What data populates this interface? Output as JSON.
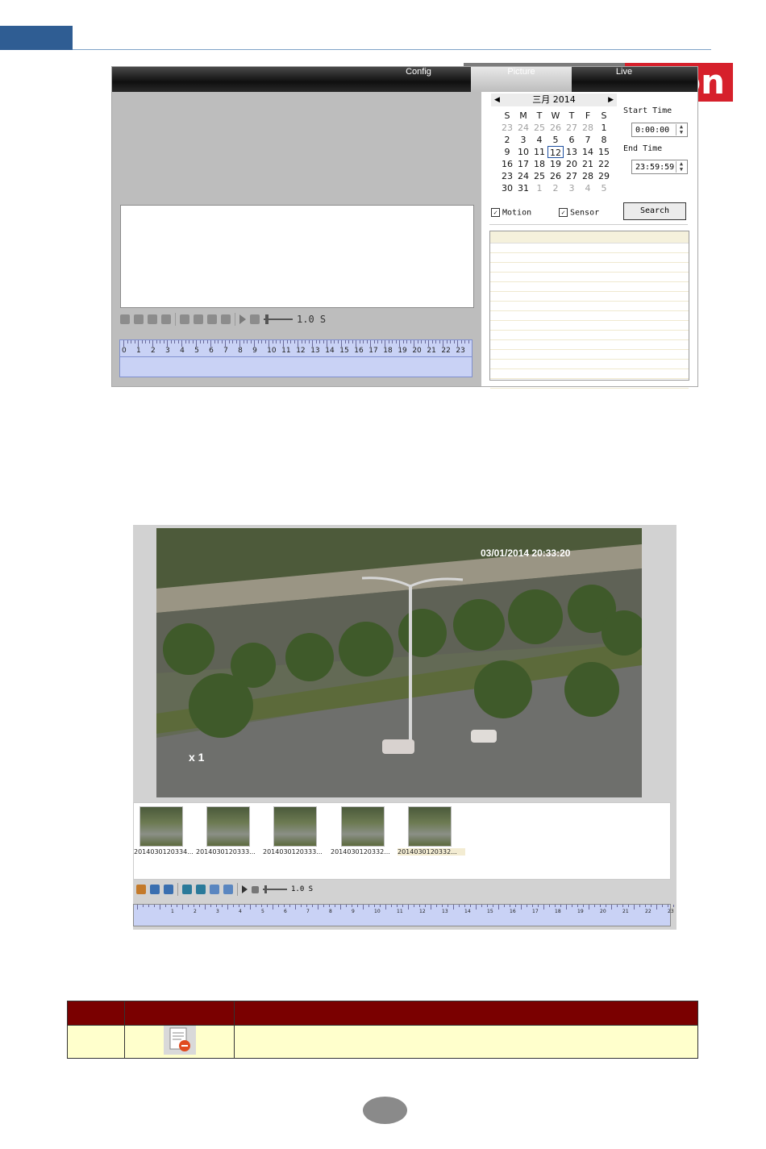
{
  "header_nav": {
    "tabs": [
      "Config",
      "Picture",
      "Live"
    ],
    "active": "Picture"
  },
  "brand_text": "on",
  "calendar": {
    "month_label": "三月 2014",
    "weekdays": [
      "S",
      "M",
      "T",
      "W",
      "T",
      "F",
      "S"
    ],
    "weeks": [
      [
        "23",
        "24",
        "25",
        "26",
        "27",
        "28",
        "1"
      ],
      [
        "2",
        "3",
        "4",
        "5",
        "6",
        "7",
        "8"
      ],
      [
        "9",
        "10",
        "11",
        "12",
        "13",
        "14",
        "15"
      ],
      [
        "16",
        "17",
        "18",
        "19",
        "20",
        "21",
        "22"
      ],
      [
        "23",
        "24",
        "25",
        "26",
        "27",
        "28",
        "29"
      ],
      [
        "30",
        "31",
        "1",
        "2",
        "3",
        "4",
        "5"
      ]
    ],
    "selected_day": "12"
  },
  "search_panel": {
    "start_label": "Start Time",
    "start_value": "0:00:00",
    "end_label": "End Time",
    "end_value": "23:59:59",
    "motion_label": "Motion",
    "sensor_label": "Sensor",
    "search_button": "Search"
  },
  "playback": {
    "speed": "1.0 S",
    "hours": [
      "0",
      "1",
      "2",
      "3",
      "4",
      "5",
      "6",
      "7",
      "8",
      "9",
      "10",
      "11",
      "12",
      "13",
      "14",
      "15",
      "16",
      "17",
      "18",
      "19",
      "20",
      "21",
      "22",
      "23"
    ]
  },
  "video": {
    "timestamp": "03/01/2014 20:33:20",
    "zoom_label": "x 1"
  },
  "thumbnails": [
    "2014030120334...",
    "2014030120333...",
    "2014030120333...",
    "2014030120332...",
    "2014030120332..."
  ],
  "playback2": {
    "speed": "1.0 S",
    "hours": [
      "1",
      "2",
      "3",
      "4",
      "5",
      "6",
      "7",
      "8",
      "9",
      "10",
      "11",
      "12",
      "13",
      "14",
      "15",
      "16",
      "17",
      "18",
      "19",
      "20",
      "21",
      "22",
      "23"
    ]
  },
  "colors": {
    "accent_blue": "#2f5d93",
    "table_header": "#7a0000",
    "table_row": "#ffffcc",
    "brand_red": "#d6202b"
  }
}
